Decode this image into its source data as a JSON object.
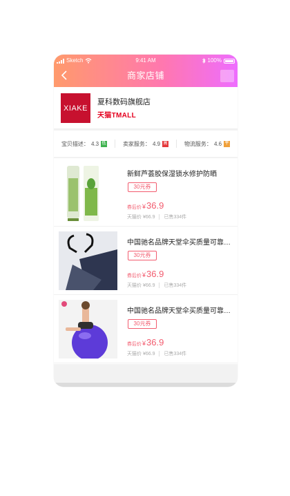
{
  "status_bar": {
    "carrier": "Sketch",
    "time": "9:41 AM",
    "battery": "100%"
  },
  "navbar": {
    "title": "商家店铺"
  },
  "store": {
    "logo_text": "XIAKE",
    "name": "夏科数码旗舰店",
    "type": "天猫TMALL"
  },
  "ratings": [
    {
      "label": "宝贝描述：",
      "score": "4.3",
      "level": "低",
      "color": "#3fb24f"
    },
    {
      "label": "卖家服务：",
      "score": "4.9",
      "level": "高",
      "color": "#e4393c"
    },
    {
      "label": "物流服务：",
      "score": "4.6",
      "level": "平",
      "color": "#f0a03a"
    }
  ],
  "products": [
    {
      "title": "新鲜芦荟胶保湿锁水修护防晒",
      "coupon": "30元券",
      "price_label": "券后价",
      "price_symbol": "¥",
      "price": "36.9",
      "original": "天猫价 ¥66.9",
      "sold": "已售334件"
    },
    {
      "title": "中国驰名品牌天堂伞买质量可靠的伞",
      "coupon": "30元券",
      "price_label": "券后价",
      "price_symbol": "¥",
      "price": "36.9",
      "original": "天猫价 ¥66.9",
      "sold": "已售334件"
    },
    {
      "title": "中国驰名品牌天堂伞买质量可靠的伞",
      "coupon": "30元券",
      "price_label": "券后价",
      "price_symbol": "¥",
      "price": "36.9",
      "original": "天猫价 ¥66.9",
      "sold": "已售334件"
    }
  ]
}
